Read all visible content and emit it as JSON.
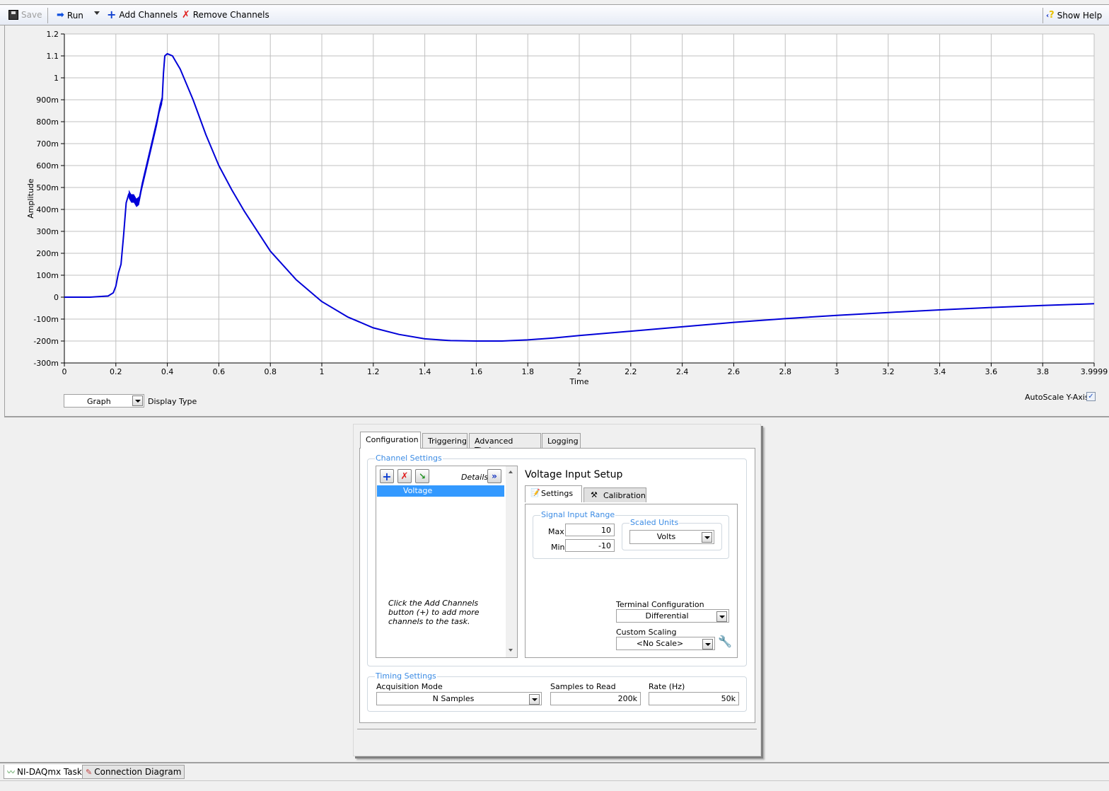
{
  "toolbar": {
    "save_label": "Save",
    "run_label": "Run",
    "add_channels_label": "Add Channels",
    "remove_channels_label": "Remove Channels",
    "show_help_label": "Show Help"
  },
  "graph": {
    "display_type": "Graph",
    "display_type_label": "Display Type",
    "autoscale_label": "AutoScale Y-Axis",
    "autoscale_checked": true
  },
  "chart_data": {
    "type": "line",
    "title": "",
    "xlabel": "Time",
    "ylabel": "Amplitude",
    "xlim": [
      0,
      3.9999
    ],
    "ylim": [
      -0.3,
      1.2
    ],
    "grid": true,
    "x_ticks": [
      "0",
      "0.2",
      "0.4",
      "0.6",
      "0.8",
      "1",
      "1.2",
      "1.4",
      "1.6",
      "1.8",
      "2",
      "2.2",
      "2.4",
      "2.6",
      "2.8",
      "3",
      "3.2",
      "3.4",
      "3.6",
      "3.8",
      "3.9999"
    ],
    "x_tick_values": [
      0,
      0.2,
      0.4,
      0.6,
      0.8,
      1,
      1.2,
      1.4,
      1.6,
      1.8,
      2,
      2.2,
      2.4,
      2.6,
      2.8,
      3,
      3.2,
      3.4,
      3.6,
      3.8,
      3.9999
    ],
    "y_ticks": [
      "1.2",
      "1.1",
      "1",
      "900m",
      "800m",
      "700m",
      "600m",
      "500m",
      "400m",
      "300m",
      "200m",
      "100m",
      "0",
      "-100m",
      "-200m",
      "-300m"
    ],
    "y_tick_values": [
      1.2,
      1.1,
      1.0,
      0.9,
      0.8,
      0.7,
      0.6,
      0.5,
      0.4,
      0.3,
      0.2,
      0.1,
      0,
      -0.1,
      -0.2,
      -0.3
    ],
    "series": [
      {
        "name": "Voltage",
        "color": "#0000d8",
        "x": [
          0,
          0.1,
          0.17,
          0.19,
          0.2,
          0.21,
          0.22,
          0.23,
          0.24,
          0.25,
          0.26,
          0.27,
          0.28,
          0.29,
          0.3,
          0.32,
          0.34,
          0.36,
          0.37,
          0.38,
          0.385,
          0.39,
          0.4,
          0.41,
          0.42,
          0.43,
          0.45,
          0.5,
          0.55,
          0.6,
          0.65,
          0.7,
          0.8,
          0.9,
          1.0,
          1.1,
          1.2,
          1.3,
          1.4,
          1.5,
          1.6,
          1.7,
          1.8,
          1.9,
          2.0,
          2.2,
          2.4,
          2.6,
          2.8,
          3.0,
          3.2,
          3.4,
          3.6,
          3.8,
          3.9999
        ],
        "y": [
          0,
          0,
          0.005,
          0.02,
          0.05,
          0.11,
          0.15,
          0.28,
          0.43,
          0.47,
          0.45,
          0.45,
          0.43,
          0.44,
          0.5,
          0.6,
          0.7,
          0.8,
          0.86,
          0.9,
          1.02,
          1.1,
          1.11,
          1.105,
          1.1,
          1.08,
          1.04,
          0.9,
          0.74,
          0.6,
          0.49,
          0.39,
          0.21,
          0.08,
          -0.02,
          -0.09,
          -0.14,
          -0.17,
          -0.19,
          -0.198,
          -0.2,
          -0.2,
          -0.195,
          -0.186,
          -0.175,
          -0.155,
          -0.135,
          -0.115,
          -0.098,
          -0.083,
          -0.07,
          -0.058,
          -0.047,
          -0.038,
          -0.03
        ]
      }
    ]
  },
  "config": {
    "tabs": [
      "Configuration",
      "Triggering",
      "Advanced Timing",
      "Logging"
    ],
    "channel_settings_title": "Channel Settings",
    "details_label": "Details",
    "channels": [
      "Voltage"
    ],
    "hint_text": "Click the Add Channels button (+) to add more channels to the task.",
    "setup_title": "Voltage Input Setup",
    "subtabs": [
      "Settings",
      "Calibration"
    ],
    "signal_input_range_title": "Signal Input Range",
    "max_label": "Max",
    "max_value": "10",
    "min_label": "Min",
    "min_value": "-10",
    "scaled_units_title": "Scaled Units",
    "scaled_units_value": "Volts",
    "terminal_config_label": "Terminal Configuration",
    "terminal_config_value": "Differential",
    "custom_scaling_label": "Custom Scaling",
    "custom_scaling_value": "<No Scale>",
    "timing_title": "Timing Settings",
    "acq_mode_label": "Acquisition Mode",
    "acq_mode_value": "N Samples",
    "samples_label": "Samples to Read",
    "samples_value": "200k",
    "rate_label": "Rate (Hz)",
    "rate_value": "50k"
  },
  "bottom_tabs": [
    "NI-DAQmx Task",
    "Connection Diagram"
  ]
}
